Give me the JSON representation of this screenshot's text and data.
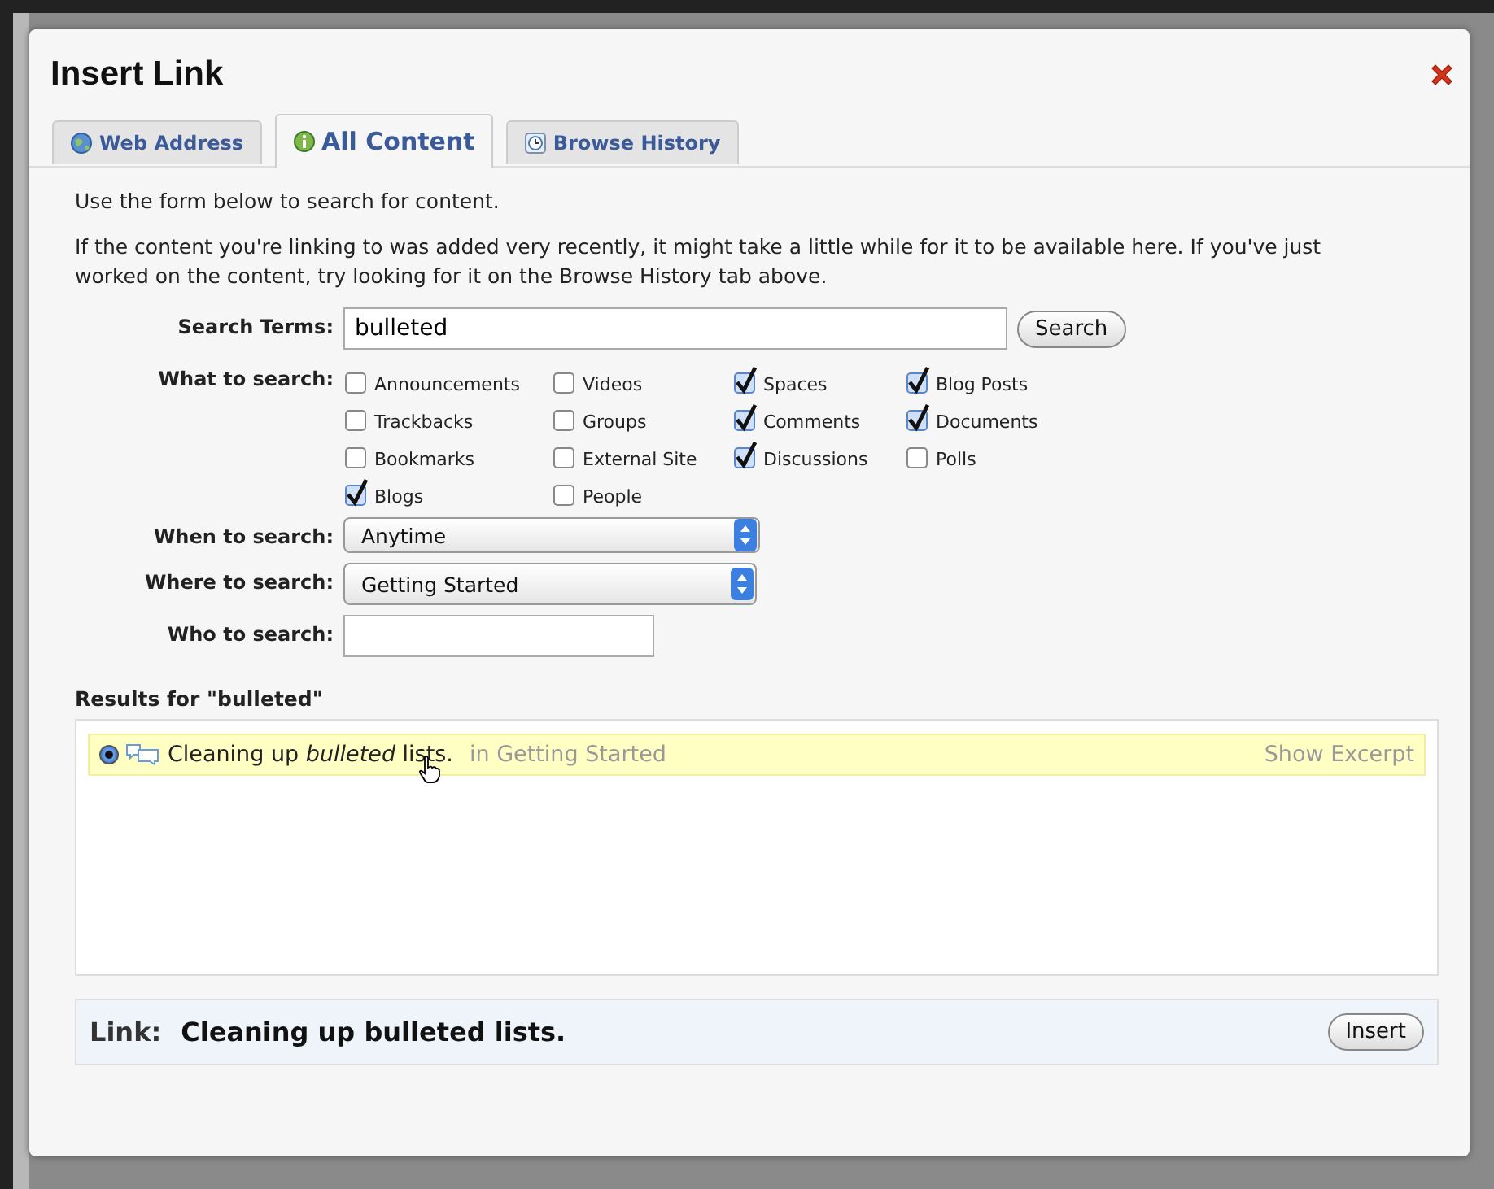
{
  "dialog": {
    "title": "Insert Link"
  },
  "tabs": [
    {
      "label": "Web Address",
      "selected": false
    },
    {
      "label": "All Content",
      "selected": true
    },
    {
      "label": "Browse History",
      "selected": false
    }
  ],
  "intro": [
    "Use the form below to search for content.",
    "If the content you're linking to was added very recently, it might take a little while for it to be available here. If you've just worked on the content, try looking for it on the Browse History tab above."
  ],
  "search_terms": {
    "label": "Search Terms:",
    "value": "bulleted",
    "button": "Search"
  },
  "what_to_search": {
    "label": "What to search:",
    "columns": [
      [
        {
          "label": "Announcements",
          "checked": false
        },
        {
          "label": "Trackbacks",
          "checked": false
        },
        {
          "label": "Bookmarks",
          "checked": false
        },
        {
          "label": "Blogs",
          "checked": true
        }
      ],
      [
        {
          "label": "Videos",
          "checked": false
        },
        {
          "label": "Groups",
          "checked": false
        },
        {
          "label": "External Site",
          "checked": false
        },
        {
          "label": "People",
          "checked": false
        }
      ],
      [
        {
          "label": "Spaces",
          "checked": true
        },
        {
          "label": "Comments",
          "checked": true
        },
        {
          "label": "Discussions",
          "checked": true
        }
      ],
      [
        {
          "label": "Blog Posts",
          "checked": true
        },
        {
          "label": "Documents",
          "checked": true
        },
        {
          "label": "Polls",
          "checked": false
        }
      ]
    ]
  },
  "when_to_search": {
    "label": "When to search:",
    "value": "Anytime"
  },
  "where_to_search": {
    "label": "Where to search:",
    "value": "Getting Started"
  },
  "who_to_search": {
    "label": "Who to search:"
  },
  "results": {
    "heading": "Results for \"bulleted\"",
    "items": [
      {
        "title": "Cleaning up *bulleted* lists.",
        "location": "in Getting Started",
        "action": "Show Excerpt",
        "selected": true
      }
    ]
  },
  "link": {
    "label": "Link:",
    "value": "Cleaning up bulleted lists.",
    "button": "Insert"
  }
}
